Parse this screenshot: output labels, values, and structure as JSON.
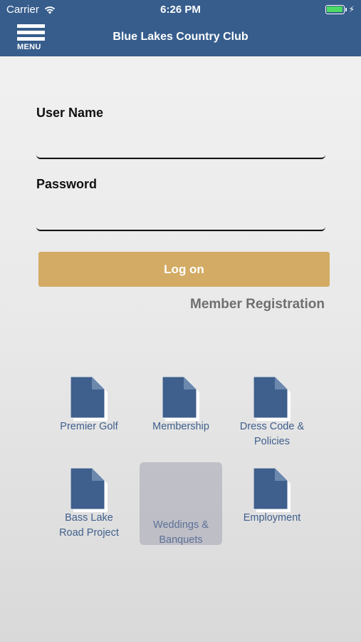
{
  "status_bar": {
    "carrier": "Carrier",
    "time": "6:26 PM",
    "battery_level": 1.0
  },
  "nav_bar": {
    "menu_label": "MENU",
    "title": "Blue Lakes Country Club"
  },
  "login": {
    "username_label": "User Name",
    "username_value": "",
    "password_label": "Password",
    "password_value": "",
    "login_button": "Log on",
    "registration_link": "Member Registration"
  },
  "tiles": [
    {
      "label": "Premier Golf",
      "icon": "document-icon"
    },
    {
      "label": "Membership",
      "icon": "document-icon"
    },
    {
      "label": "Dress Code & Policies",
      "icon": "document-icon"
    },
    {
      "label": "Bass Lake Road Project",
      "icon": "document-icon"
    },
    {
      "label": "Weddings & Banquets",
      "icon": "photo-thumbnail"
    },
    {
      "label": "Employment",
      "icon": "document-icon"
    }
  ],
  "colors": {
    "nav_blue": "#365d8c",
    "button_gold": "#d3ab64",
    "tile_text": "#3f5f8c",
    "battery_green": "#4cd964"
  }
}
